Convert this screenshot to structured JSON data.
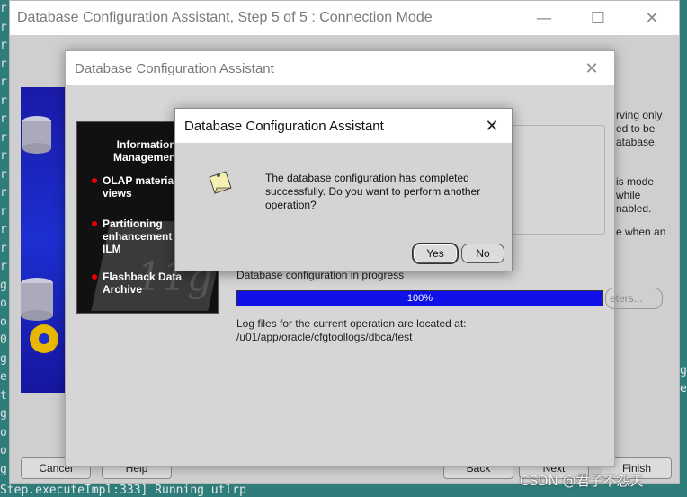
{
  "terminal": {
    "left_chars": [
      "r",
      "r",
      "r",
      "r",
      "r",
      "r",
      "r",
      "r",
      "r",
      "r",
      "r",
      "r",
      "r",
      "r",
      "r",
      "g",
      "o",
      "o",
      "0",
      "g",
      "e",
      "t",
      "g",
      "o",
      "o",
      "g"
    ],
    "bottom_line": "Step.executeImpl:333] Running utlrp",
    "right_chars": [
      "g",
      "e"
    ]
  },
  "main_window": {
    "title": "Database Configuration Assistant, Step 5 of 5 : Connection Mode",
    "right_text": [
      "rving only",
      "ed to be",
      "atabase.",
      "is mode",
      "while",
      "nabled.",
      "e when an"
    ],
    "bottom_buttons": {
      "cancel": "Cancel",
      "help": "Help",
      "back": "Back",
      "next": "Next",
      "finish": "Finish"
    }
  },
  "progress_dialog": {
    "title": "Database Configuration Assistant",
    "promo": {
      "title_lines": [
        "Information",
        "Management"
      ],
      "items": [
        {
          "lines": [
            "OLAP materia",
            "views"
          ]
        },
        {
          "lines": [
            "Partitioning",
            "enhancement",
            "ILM"
          ]
        },
        {
          "lines": [
            "Flashback Data",
            "Archive"
          ]
        }
      ],
      "logo": "11g"
    },
    "progress_label": "Database configuration in progress",
    "progress_percent": 1.0,
    "progress_text": "100%",
    "log_line_1": "Log files for the current operation are located at:",
    "log_line_2": "/u01/app/oracle/cfgtoollogs/dbca/test",
    "side_button": "eters..."
  },
  "confirm_dialog": {
    "title": "Database Configuration Assistant",
    "message": "The database configuration has completed successfully. Do you want to perform another operation?",
    "yes_label": "Yes",
    "no_label": "No"
  },
  "watermark": "CSDN @君子不怨天",
  "colors": {
    "progress_fill": "#1010e8",
    "banner_blue": "#1c2fd0",
    "terminal_bg": "#2e7d7a"
  }
}
